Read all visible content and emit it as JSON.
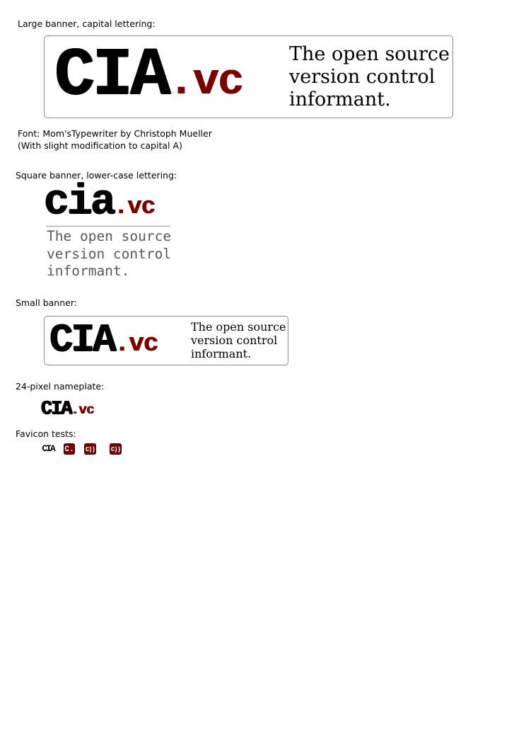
{
  "sections": {
    "large": {
      "caption": "Large banner, capital lettering:",
      "logo_main": "CIA",
      "logo_suffix": ".vc",
      "tagline": "The open source\nversion control\ninformant."
    },
    "font_credit": {
      "line1": "Font: Mom'sTypewriter by Christoph Mueller",
      "line2": "(With slight modification to capital A)"
    },
    "square": {
      "caption": "Square banner, lower-case lettering:",
      "logo_main": "cia",
      "logo_suffix": ".vc",
      "tagline": "The open source\nversion control\ninformant."
    },
    "small": {
      "caption": "Small banner:",
      "logo_main": "CIA",
      "logo_suffix": ".vc",
      "tagline": "The open source\nversion control\ninformant."
    },
    "nameplate": {
      "caption": "24-pixel nameplate:",
      "logo_main": "CIA",
      "logo_suffix": ".vc"
    },
    "favicons": {
      "caption": "Favicon tests:",
      "icons": [
        {
          "label": "CIA",
          "style": "plain"
        },
        {
          "label": "C.",
          "style": "red"
        },
        {
          "label": "C))",
          "style": "red"
        },
        {
          "label": "C))",
          "style": "red"
        }
      ]
    }
  },
  "colors": {
    "accent": "#7a0000",
    "border": "#8c8c8c",
    "tagline_gray": "#5a5a5a"
  }
}
